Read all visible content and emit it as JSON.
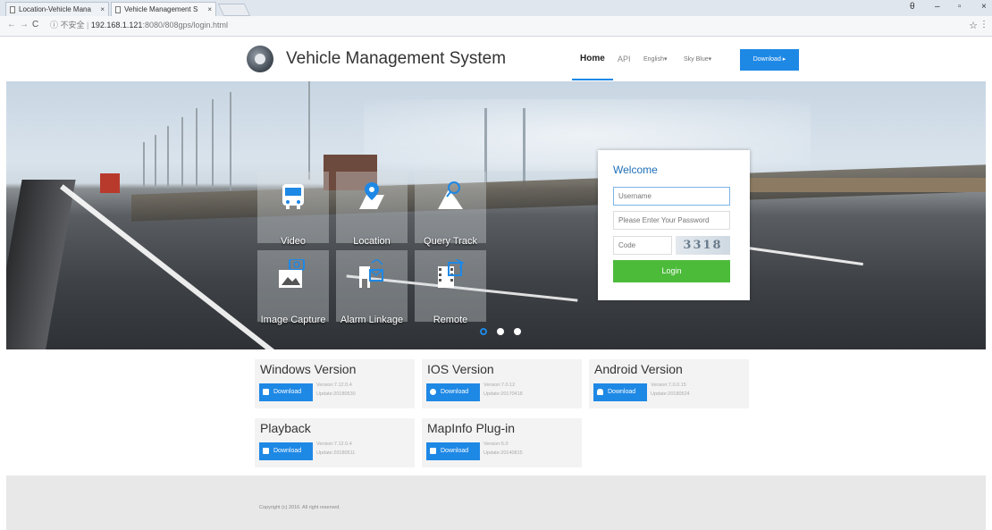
{
  "browser": {
    "tabs": [
      {
        "label": "Location-Vehicle Mana"
      },
      {
        "label": "Vehicle Management S"
      }
    ],
    "tab_close": "×",
    "url_security": "ⓘ 不安全",
    "url_host": "192.168.1.121",
    "url_path": ":8080/808gps/login.html",
    "window_controls": {
      "account": "θ",
      "minimize": "–",
      "maximize": "▫",
      "close": "×"
    },
    "nav": {
      "back": "←",
      "forward": "→",
      "reload": "C"
    },
    "star": "☆",
    "menu": "⋮"
  },
  "header": {
    "title": "Vehicle Management System",
    "nav_home": "Home",
    "nav_api": "API",
    "nav_lang": "English▾",
    "nav_theme": "Sky Blue▾",
    "download_btn": "Download ▸"
  },
  "features": [
    {
      "label": "Video",
      "icon": "bus-icon"
    },
    {
      "label": "Location",
      "icon": "map-pin-icon"
    },
    {
      "label": "Query Track",
      "icon": "track-search-icon"
    },
    {
      "label": "Image Capture",
      "icon": "image-capture-icon"
    },
    {
      "label": "Alarm Linkage",
      "icon": "alarm-linkage-icon"
    },
    {
      "label": "Remote",
      "icon": "remote-film-icon"
    }
  ],
  "carousel": {
    "count": 3,
    "active": 0
  },
  "login": {
    "welcome": "Welcome",
    "username_placeholder": "Username",
    "password_placeholder": "Please Enter Your Password",
    "code_placeholder": "Code",
    "captcha": "3318",
    "login_btn": "Login"
  },
  "downloads": [
    {
      "title": "Windows Version",
      "button": "Download",
      "version": "Version:7.12.0.4",
      "update": "Update:20180530",
      "icon": "windows-icon"
    },
    {
      "title": "IOS Version",
      "button": "Download",
      "version": "Version:7.0.12",
      "update": "Update:20170418",
      "icon": "apple-icon"
    },
    {
      "title": "Android Version",
      "button": "Download",
      "version": "Version:7.0.0.15",
      "update": "Update:20180524",
      "icon": "android-icon"
    },
    {
      "title": "Playback",
      "button": "Download",
      "version": "Version:7.12.0.4",
      "update": "Update:20180511",
      "icon": "windows-icon"
    },
    {
      "title": "MapInfo Plug-in",
      "button": "Download",
      "version": "Version:5.0",
      "update": "Update:20140815",
      "icon": "windows-icon"
    }
  ],
  "footer": {
    "copyright": "Copyright (c) 2016. All right reserved."
  },
  "colors": {
    "accent": "#1e88e5",
    "login_green": "#4cbb3a"
  }
}
